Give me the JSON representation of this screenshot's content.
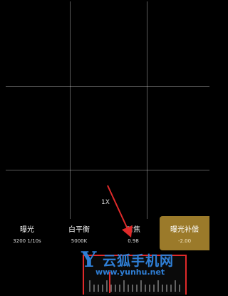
{
  "viewfinder": {
    "zoom": "1X"
  },
  "controls": [
    {
      "name": "曝光",
      "value": "3200 1/10s"
    },
    {
      "name": "白平衡",
      "value": "5000K"
    },
    {
      "name": "对焦",
      "value": "0.98"
    },
    {
      "name": "曝光补偿",
      "value": "-2.00"
    }
  ],
  "watermark": {
    "logo": "Y",
    "title": "云狐手机网",
    "url": "www.yunhu.net"
  },
  "colors": {
    "accent": "#9b7a2a",
    "highlight": "#e02a2a",
    "watermark": "#2f7fd6"
  }
}
